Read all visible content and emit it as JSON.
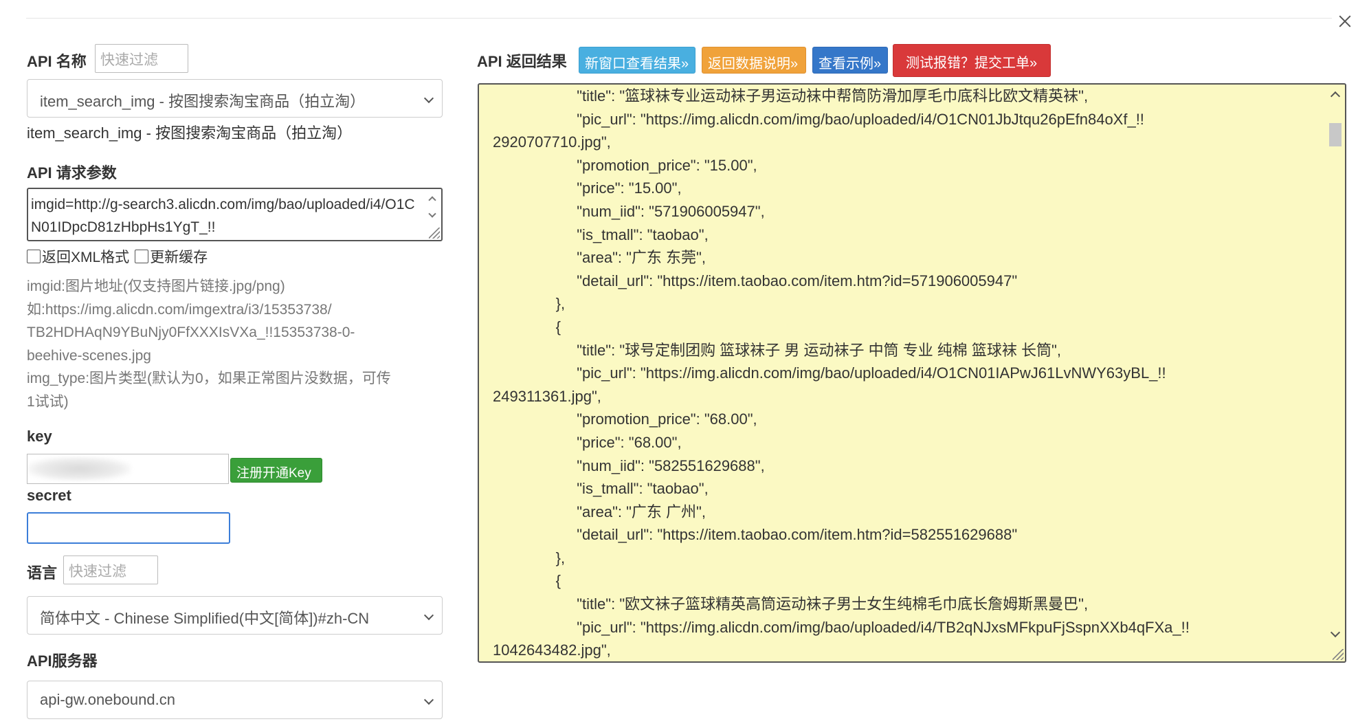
{
  "api_name": {
    "label": "API 名称",
    "filter_placeholder": "快速过滤",
    "selected": "item_search_img - 按图搜索淘宝商品（拍立淘）",
    "description": "item_search_img - 按图搜索淘宝商品（拍立淘）"
  },
  "params": {
    "label": "API 请求参数",
    "value": "imgid=http://g-search3.alicdn.com/img/bao/uploaded/i4/O1CN01IDpcD81zHbpHs1YgT_!!",
    "return_xml_label": "返回XML格式",
    "refresh_cache_label": "更新缓存",
    "help_lines": [
      "imgid:图片地址(仅支持图片链接.jpg/png)",
      "如:https://img.alicdn.com/imgextra/i3/15353738/",
      "TB2HDHAqN9YBuNjy0FfXXXIsVXa_!!15353738-0-",
      "beehive-scenes.jpg",
      "img_type:图片类型(默认为0，如果正常图片没数据，可传",
      "1试试)"
    ]
  },
  "key": {
    "label": "key",
    "register_button": "注册开通Key"
  },
  "secret": {
    "label": "secret"
  },
  "language": {
    "label": "语言",
    "filter_placeholder": "快速过滤",
    "selected": "简体中文 - Chinese Simplified(中文[简体])#zh-CN"
  },
  "server": {
    "label": "API服务器",
    "selected": "api-gw.onebound.cn"
  },
  "result": {
    "label": "API 返回结果",
    "buttons": {
      "new_window": "新窗口查看结果»",
      "data_desc": "返回数据说明»",
      "example": "查看示例»",
      "report": "测试报错？提交工单»"
    },
    "lines": [
      "                    \"title\": \"篮球袜专业运动袜子男运动袜中帮筒防滑加厚毛巾底科比欧文精英袜\",",
      "                    \"pic_url\": \"https://img.alicdn.com/img/bao/uploaded/i4/O1CN01JbJtqu26pEfn84oXf_!!",
      "2920707710.jpg\",",
      "                    \"promotion_price\": \"15.00\",",
      "                    \"price\": \"15.00\",",
      "                    \"num_iid\": \"571906005947\",",
      "                    \"is_tmall\": \"taobao\",",
      "                    \"area\": \"广东 东莞\",",
      "                    \"detail_url\": \"https://item.taobao.com/item.htm?id=571906005947\"",
      "               },",
      "               {",
      "                    \"title\": \"球号定制团购 篮球袜子 男 运动袜子 中筒 专业 纯棉 篮球袜 长筒\",",
      "                    \"pic_url\": \"https://img.alicdn.com/img/bao/uploaded/i4/O1CN01IAPwJ61LvNWY63yBL_!!",
      "249311361.jpg\",",
      "                    \"promotion_price\": \"68.00\",",
      "                    \"price\": \"68.00\",",
      "                    \"num_iid\": \"582551629688\",",
      "                    \"is_tmall\": \"taobao\",",
      "                    \"area\": \"广东 广州\",",
      "                    \"detail_url\": \"https://item.taobao.com/item.htm?id=582551629688\"",
      "               },",
      "               {",
      "                    \"title\": \"欧文袜子篮球精英高筒运动袜子男士女生纯棉毛巾底长詹姆斯黑曼巴\",",
      "                    \"pic_url\": \"https://img.alicdn.com/img/bao/uploaded/i4/TB2qNJxsMFkpuFjSspnXXb4qFXa_!!",
      "1042643482.jpg\","
    ]
  },
  "icons": {
    "close": "close-icon",
    "chevron": "chevron-down-icon"
  },
  "colors": {
    "result_bg": "#fbf9c3",
    "btn_light_blue": "#49afe0",
    "btn_orange": "#f0a23a",
    "btn_blue": "#3577c9",
    "btn_red": "#d9393a",
    "btn_green": "#3a9f3a",
    "focus_blue": "#3b7dd8"
  }
}
